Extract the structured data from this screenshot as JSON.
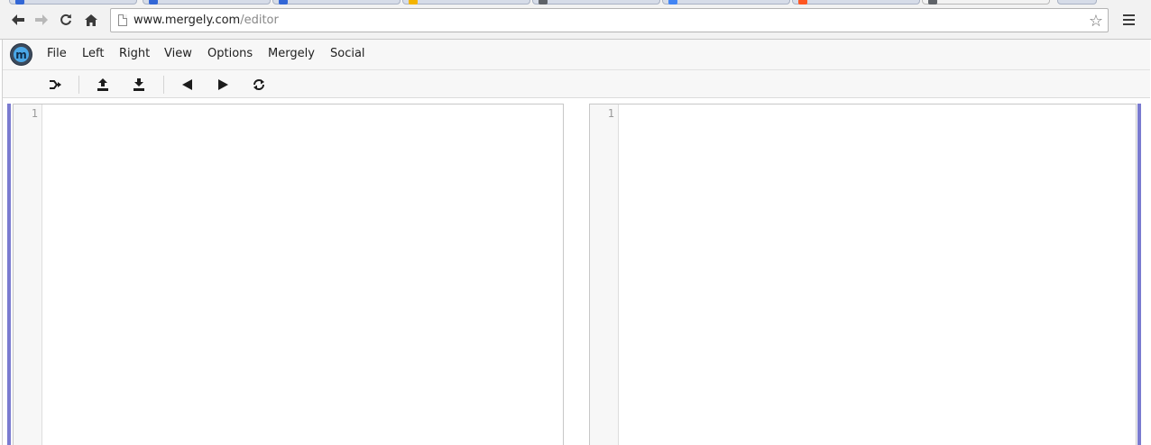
{
  "browser": {
    "url_host": "www.mergely.com",
    "url_path": "/editor",
    "tab_favicon_colors": [
      "#3367d6",
      "#3367d6",
      "#f4b400",
      "#5f6368",
      "#4285f4",
      "#ff5722",
      "#5f6368"
    ]
  },
  "menubar": {
    "logo_letter": "m",
    "items": [
      "File",
      "Left",
      "Right",
      "View",
      "Options",
      "Mergely",
      "Social"
    ]
  },
  "toolbar": {
    "buttons": [
      "compare",
      "upload",
      "download",
      "previous-diff",
      "next-diff",
      "swap"
    ]
  },
  "editors": {
    "left": {
      "line_numbers": [
        "1"
      ]
    },
    "right": {
      "line_numbers": [
        "1"
      ]
    }
  },
  "colors": {
    "change_marker": "#7a7bd0",
    "logo_ring": "#3b4a5c",
    "logo_fill": "#4aa8e8"
  }
}
